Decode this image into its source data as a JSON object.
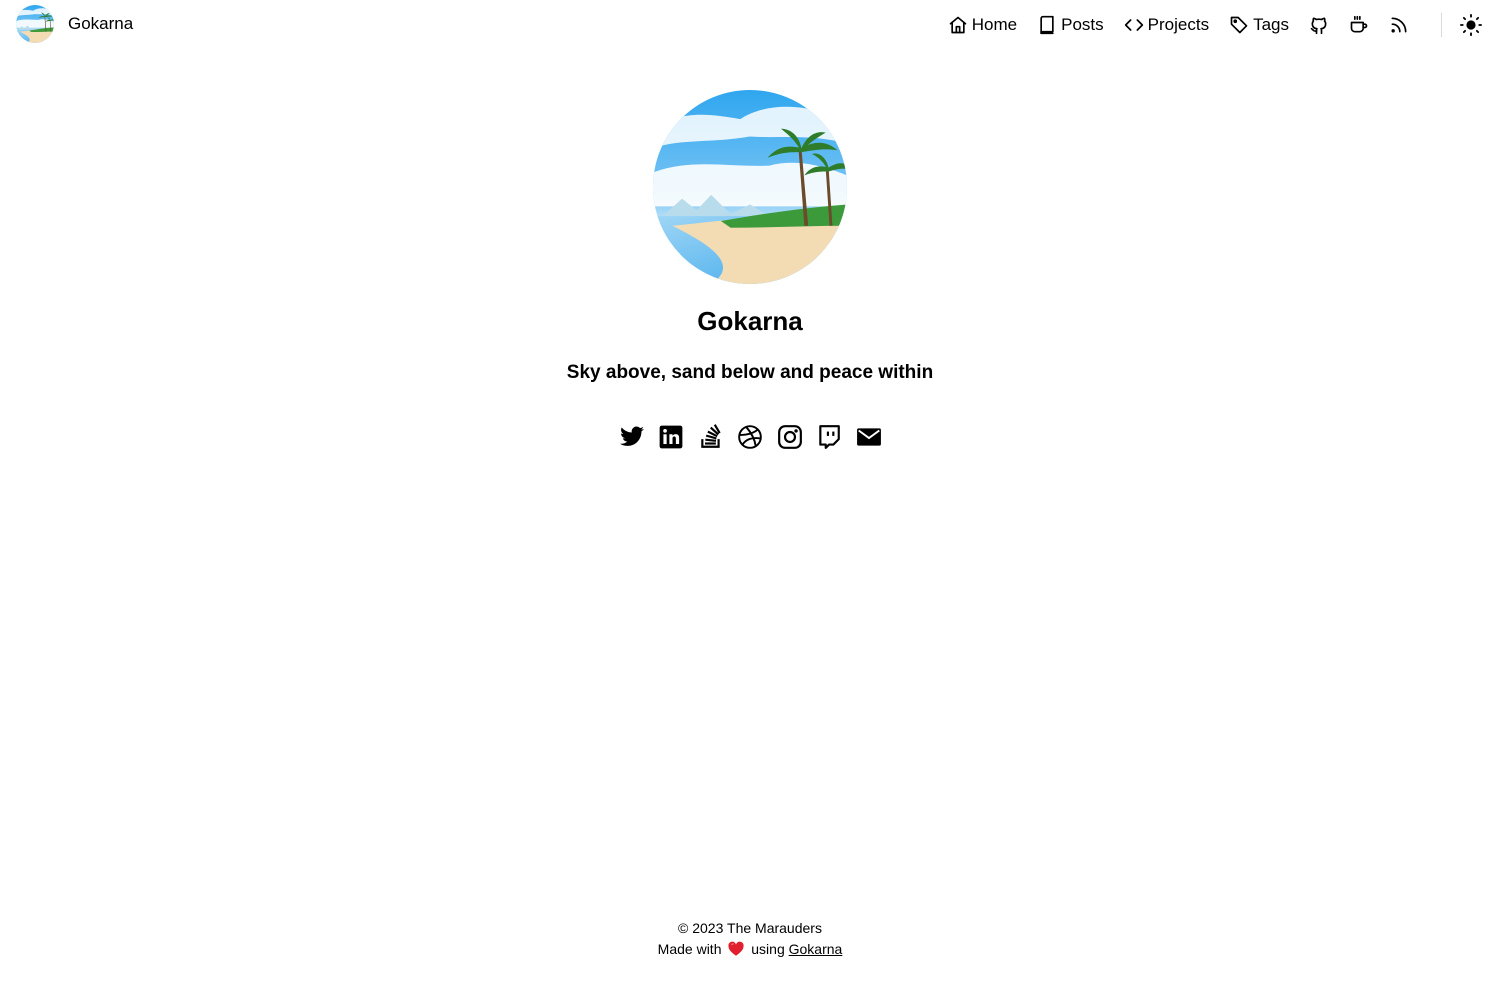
{
  "site": {
    "name": "Gokarna"
  },
  "nav": {
    "items": [
      {
        "label": "Home",
        "icon": "home-icon"
      },
      {
        "label": "Posts",
        "icon": "book-icon"
      },
      {
        "label": "Projects",
        "icon": "code-icon"
      },
      {
        "label": "Tags",
        "icon": "tag-icon"
      }
    ],
    "icon_links": [
      "github-icon",
      "coffee-icon",
      "rss-icon"
    ],
    "theme_toggle_icon": "sun-icon"
  },
  "hero": {
    "title": "Gokarna",
    "subtitle": "Sky above, sand below and peace within",
    "avatar_icon": "beach-avatar"
  },
  "socials": [
    "twitter-icon",
    "linkedin-icon",
    "stackoverflow-icon",
    "dribbble-icon",
    "instagram-icon",
    "twitch-icon",
    "email-icon"
  ],
  "footer": {
    "copyright": "© 2023 The Marauders",
    "made_with": "Made with",
    "using": "using",
    "link_text": "Gokarna"
  },
  "colors": {
    "text": "#000000",
    "background": "#ffffff",
    "sky": "#3aaaf0",
    "sand": "#f3dcb4",
    "heart": "#e0202e"
  }
}
